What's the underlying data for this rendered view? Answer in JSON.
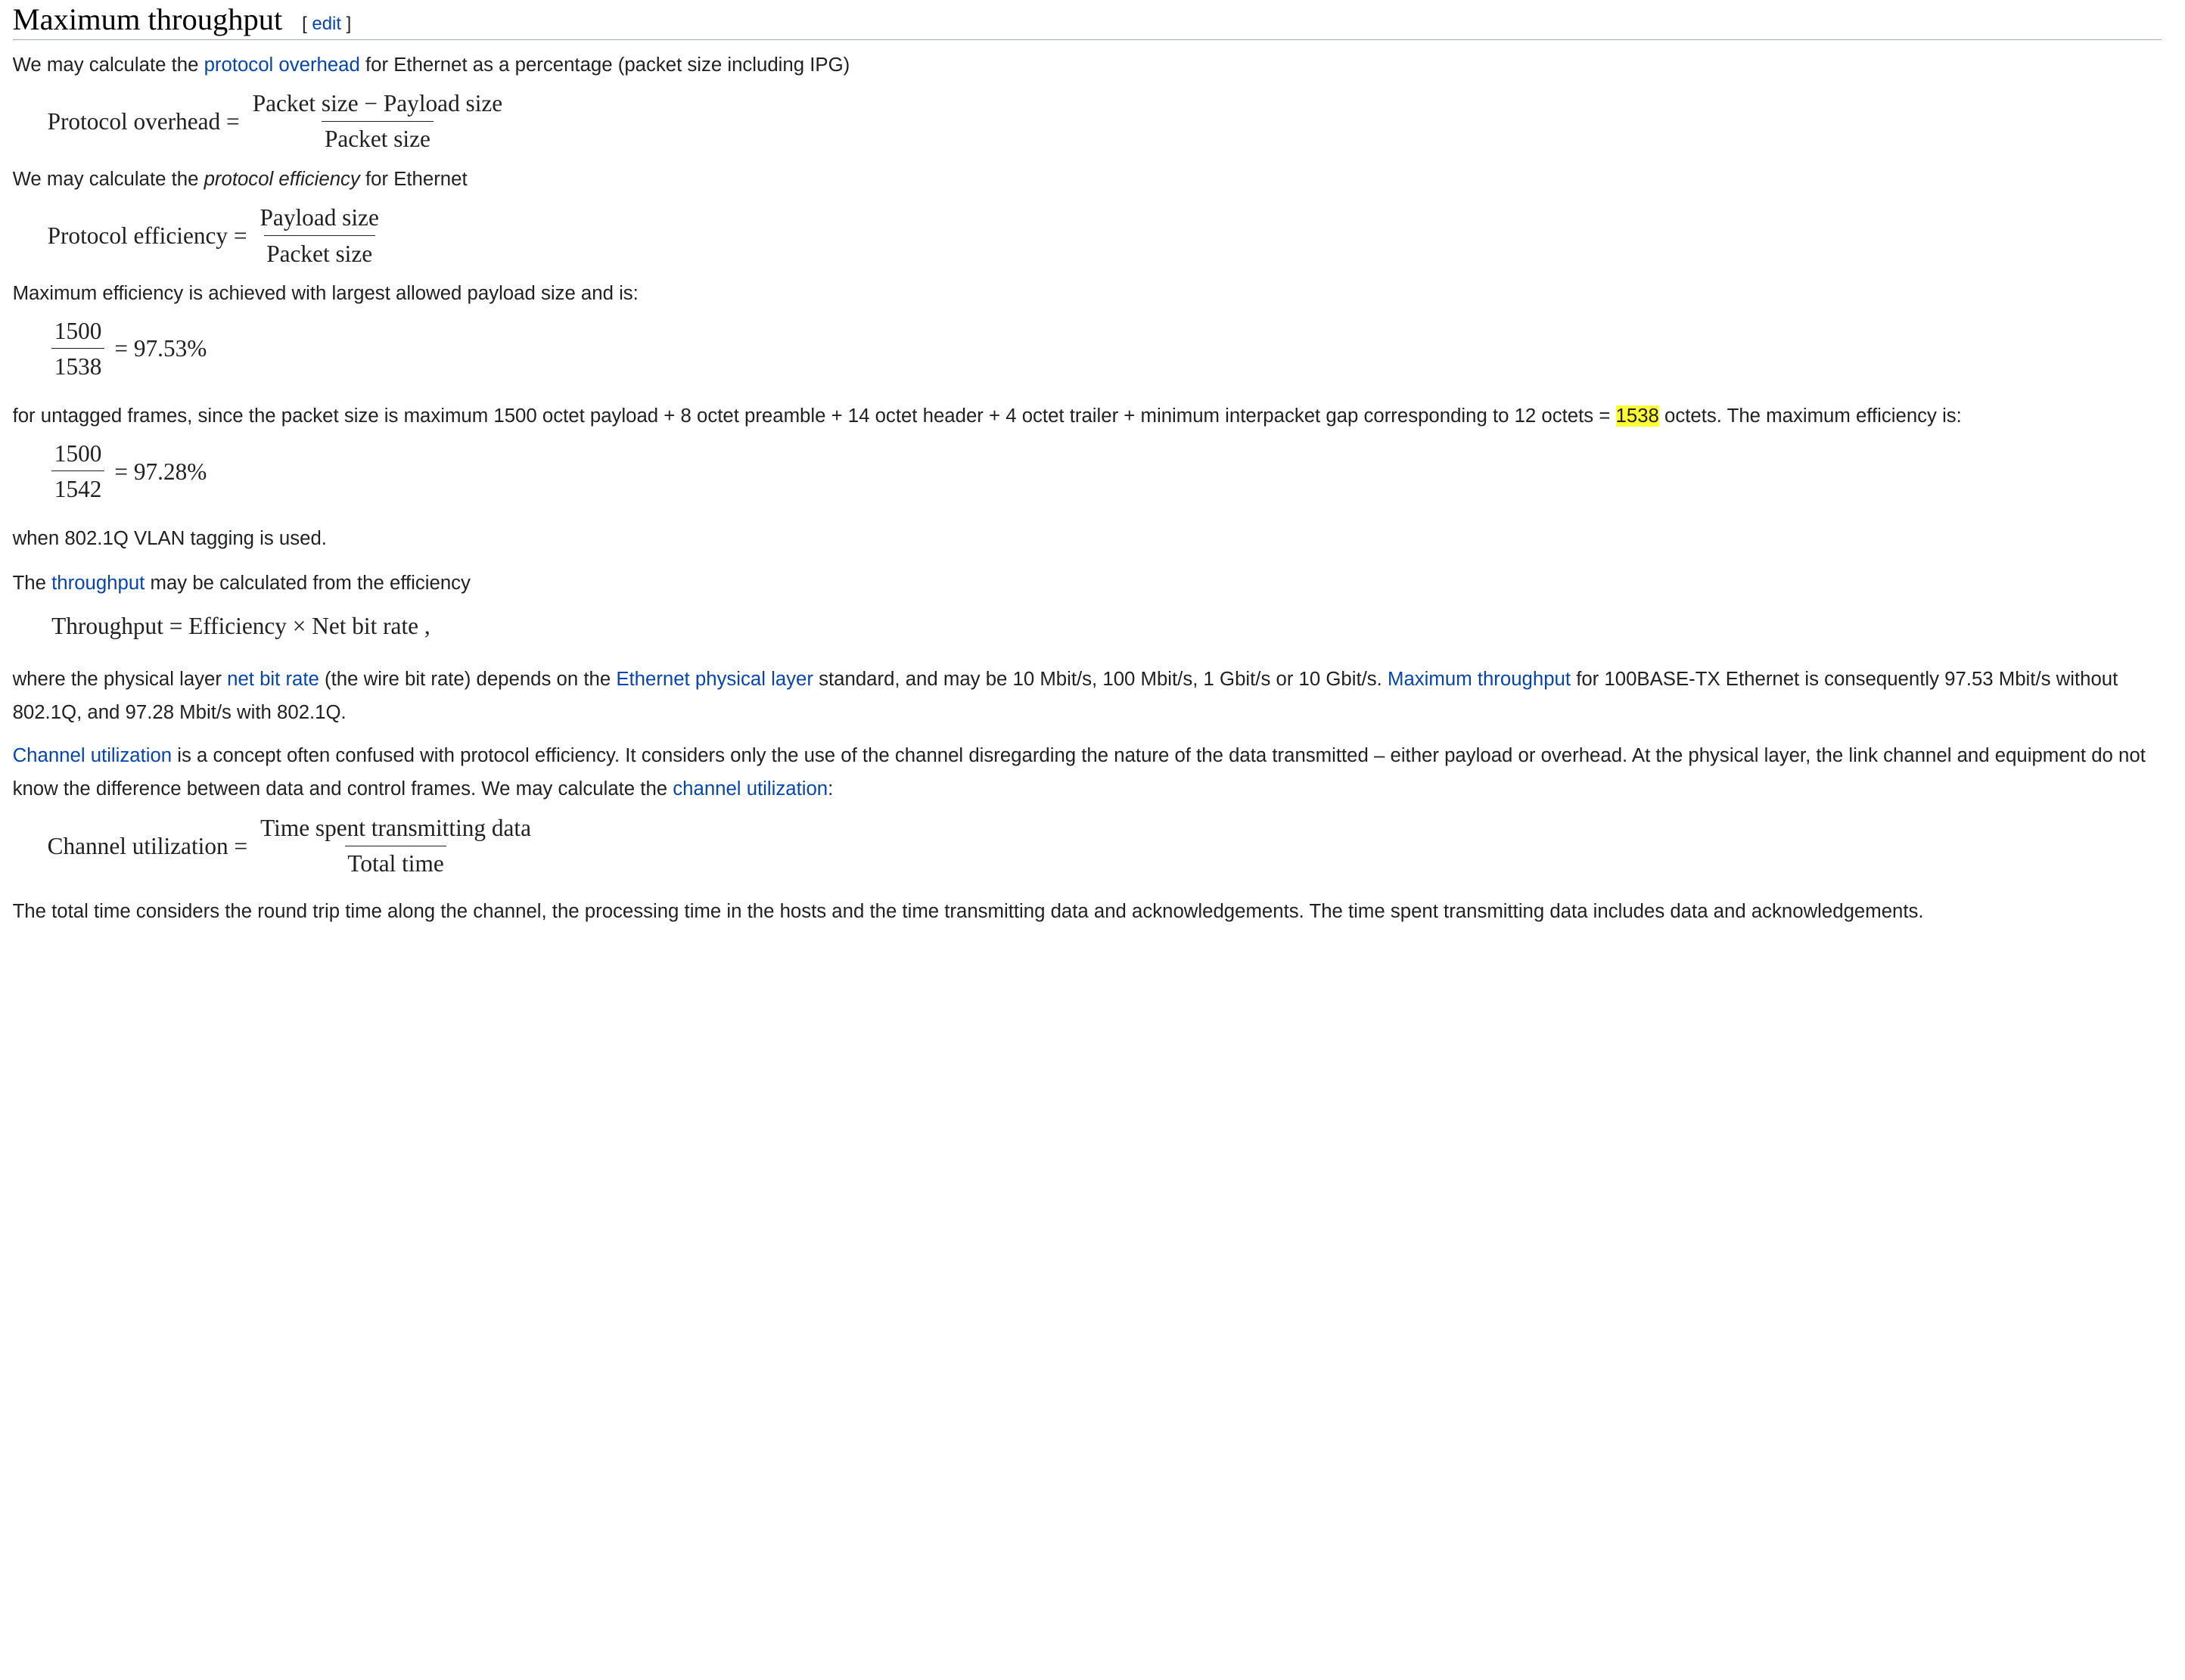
{
  "section": {
    "title": "Maximum throughput",
    "edit_open": "[ ",
    "edit_label": "edit",
    "edit_close": " ]"
  },
  "p1": {
    "t1": "We may calculate the ",
    "link": "protocol overhead",
    "t2": " for Ethernet as a percentage (packet size including IPG)"
  },
  "f_overhead": {
    "lhs": "Protocol overhead",
    "op": " = ",
    "num": "Packet size − Payload size",
    "den": "Packet size"
  },
  "p2": {
    "t1": "We may calculate the ",
    "em": "protocol efficiency",
    "t2": " for Ethernet"
  },
  "f_efficiency": {
    "lhs": "Protocol efficiency",
    "op": " = ",
    "num": "Payload size",
    "den": "Packet size"
  },
  "p3": {
    "text": "Maximum efficiency is achieved with largest allowed payload size and is:"
  },
  "f_untagged": {
    "num": "1500",
    "den": "1538",
    "rhs": " = 97.53%"
  },
  "p4": {
    "t1": "for untagged frames, since the packet size is maximum 1500 octet payload + 8 octet preamble + 14 octet header + 4 octet trailer + minimum interpacket gap corresponding to 12 octets = ",
    "highlight": "1538",
    "t2": " octets. The maximum efficiency is:"
  },
  "f_tagged": {
    "num": "1500",
    "den": "1542",
    "rhs": " = 97.28%"
  },
  "p5": {
    "text": "when 802.1Q VLAN tagging is used."
  },
  "p6": {
    "t1": "The ",
    "link": "throughput",
    "t2": " may be calculated from the efficiency"
  },
  "f_throughput": {
    "text": "Throughput = Efficiency × Net bit rate ,"
  },
  "p7": {
    "t1": "where the physical layer ",
    "link1": "net bit rate",
    "t2": " (the wire bit rate) depends on the ",
    "link2": "Ethernet physical layer",
    "t3": " standard, and may be 10 Mbit/s, 100 Mbit/s, 1 Gbit/s or 10 Gbit/s. ",
    "link3": "Maximum throughput",
    "t4": " for 100BASE-TX Ethernet is consequently 97.53 Mbit/s without 802.1Q, and 97.28 Mbit/s with 802.1Q."
  },
  "p8": {
    "link1": "Channel utilization",
    "t1": " is a concept often confused with protocol efficiency. It considers only the use of the channel disregarding the nature of the data transmitted – either payload or overhead. At the physical layer, the link channel and equipment do not know the difference between data and control frames. We may calculate the ",
    "link2": "channel utilization",
    "t2": ":"
  },
  "f_channel": {
    "lhs": "Channel utilization",
    "op": " = ",
    "num": "Time spent transmitting data",
    "den": "Total time"
  },
  "p9": {
    "text": "The total time considers the round trip time along the channel, the processing time in the hosts and the time transmitting data and acknowledgements. The time spent transmitting data includes data and acknowledgements."
  },
  "colors": {
    "link": "#0645ad",
    "highlight": "#ffff33",
    "text": "#202122",
    "rule": "#a2a9b1"
  }
}
